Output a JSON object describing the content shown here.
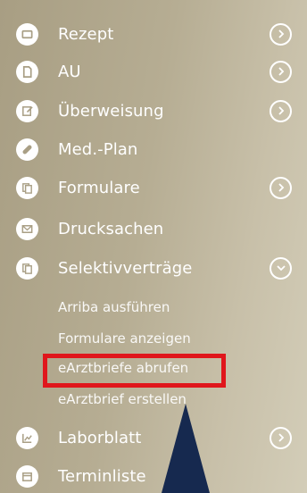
{
  "menu": {
    "items": [
      {
        "label": "Rezept",
        "icon": "prescription-icon",
        "has_chevron": true,
        "chevron": "chevron-right-icon"
      },
      {
        "label": "AU",
        "icon": "document-icon",
        "has_chevron": true,
        "chevron": "chevron-right-icon"
      },
      {
        "label": "Überweisung",
        "icon": "referral-icon",
        "has_chevron": true,
        "chevron": "chevron-right-icon"
      },
      {
        "label": "Med.-Plan",
        "icon": "pill-icon",
        "has_chevron": false
      },
      {
        "label": "Formulare",
        "icon": "forms-icon",
        "has_chevron": true,
        "chevron": "chevron-right-icon"
      },
      {
        "label": "Drucksachen",
        "icon": "envelope-icon",
        "has_chevron": false
      },
      {
        "label": "Selektivverträge",
        "icon": "contracts-icon",
        "has_chevron": true,
        "chevron": "chevron-down-icon",
        "expanded": true
      },
      {
        "label": "Laborblatt",
        "icon": "lab-chart-icon",
        "has_chevron": true,
        "chevron": "chevron-right-icon"
      },
      {
        "label": "Terminliste",
        "icon": "calendar-icon",
        "has_chevron": false
      }
    ],
    "subitems": [
      {
        "label": "Arriba ausführen"
      },
      {
        "label": "Formulare anzeigen"
      },
      {
        "label": "eArztbriefe abrufen",
        "highlighted": true
      },
      {
        "label": "eArztbrief erstellen"
      }
    ]
  },
  "colors": {
    "background_start": "#a89e83",
    "background_end": "#d3cdb8",
    "text": "#ffffff",
    "highlight_border": "#e0161c",
    "arrow": "#16294f"
  }
}
